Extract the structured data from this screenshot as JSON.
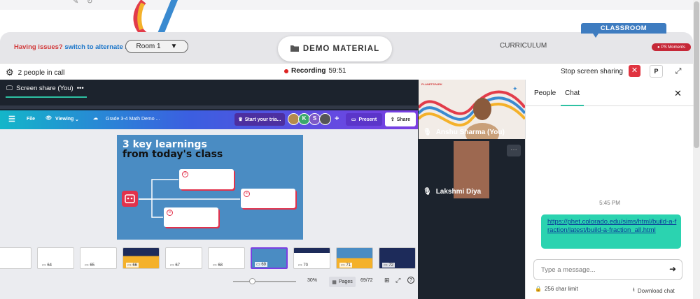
{
  "header": {
    "issues_text": "Having issues?",
    "issues_link": "switch to alternate room",
    "room_label": "Room 1",
    "demo_label": "DEMO MATERIAL",
    "curriculum_label": "CURRICULUM",
    "classroom_label": "CLASSROOM",
    "moments_label": "PS Moments"
  },
  "callbar": {
    "people_count": "2 people in call",
    "recording_label": "Recording",
    "recording_time": "59:51",
    "stop_share_label": "Stop screen sharing",
    "p_button": "P"
  },
  "stage": {
    "share_tab_label": "Screen share (You)",
    "share_tab_menu": "•••"
  },
  "canva": {
    "menu_file": "File",
    "menu_viewing": "Viewing",
    "doc_title": "Grade 3-4 Math Demo ...",
    "trial_label": "Start your tria...",
    "avatar_k": "K",
    "avatar_s": "S",
    "add_label": "+",
    "present_label": "Present",
    "share_label": "Share",
    "zoom_label": "30%",
    "pages_label": "Pages",
    "page_counter": "69/72",
    "slide_title_1": "3 key learnings",
    "slide_title_2": "from today's class",
    "box_nums": [
      "①",
      "②",
      "③"
    ],
    "thumbnails": [
      "",
      "64",
      "65",
      "66",
      "67",
      "68",
      "69",
      "70",
      "71",
      "72"
    ]
  },
  "participants": {
    "p1_name": "Anshu Sharma (You)",
    "p2_name": "Lakshmi Diya",
    "brand_small": "PLANETSPARK"
  },
  "chat": {
    "tab_people": "People",
    "tab_chat": "Chat",
    "timestamp": "5:45 PM",
    "message_link": "https://phet.colorado.edu/sims/html/build-a-fraction/latest/build-a-fraction_all.html",
    "input_placeholder": "Type a message...",
    "char_limit": "256 char limit",
    "download_label": "Download chat"
  },
  "colors": {
    "accent_teal": "#2ec1a3",
    "danger_red": "#e0333f",
    "classroom_blue": "#3e7cc0",
    "canva_purple": "#7b3ee2"
  }
}
